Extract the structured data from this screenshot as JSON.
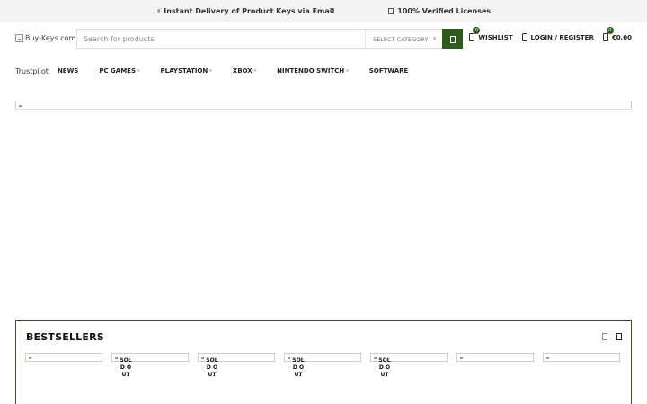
{
  "topbar": {
    "promo_1": "⚡ Instant Delivery of Product Keys via Email",
    "promo_2": "100% Verified Licenses"
  },
  "header": {
    "logo_alt": "Buy-Keys.com",
    "search_placeholder": "Search for products",
    "category_label": "SELECT CATEGORY",
    "wishlist_label": "WISHLIST",
    "wishlist_count": "0",
    "login_label": "LOGIN / REGISTER",
    "cart_count": "0",
    "cart_total": "€0,00"
  },
  "nav": {
    "trustpilot": "Trustpilot",
    "items": [
      "NEWS",
      "PC GAMES",
      "PLAYSTATION",
      "XBOX",
      "NINTENDO SWITCH",
      "SOFTWARE"
    ]
  },
  "bestsellers": {
    "title": "BESTSELLERS",
    "sold_out_label": "SOLD OUT"
  },
  "colors": {
    "accent": "#2e5a1c",
    "topbar_bg": "#f3f3f3"
  }
}
